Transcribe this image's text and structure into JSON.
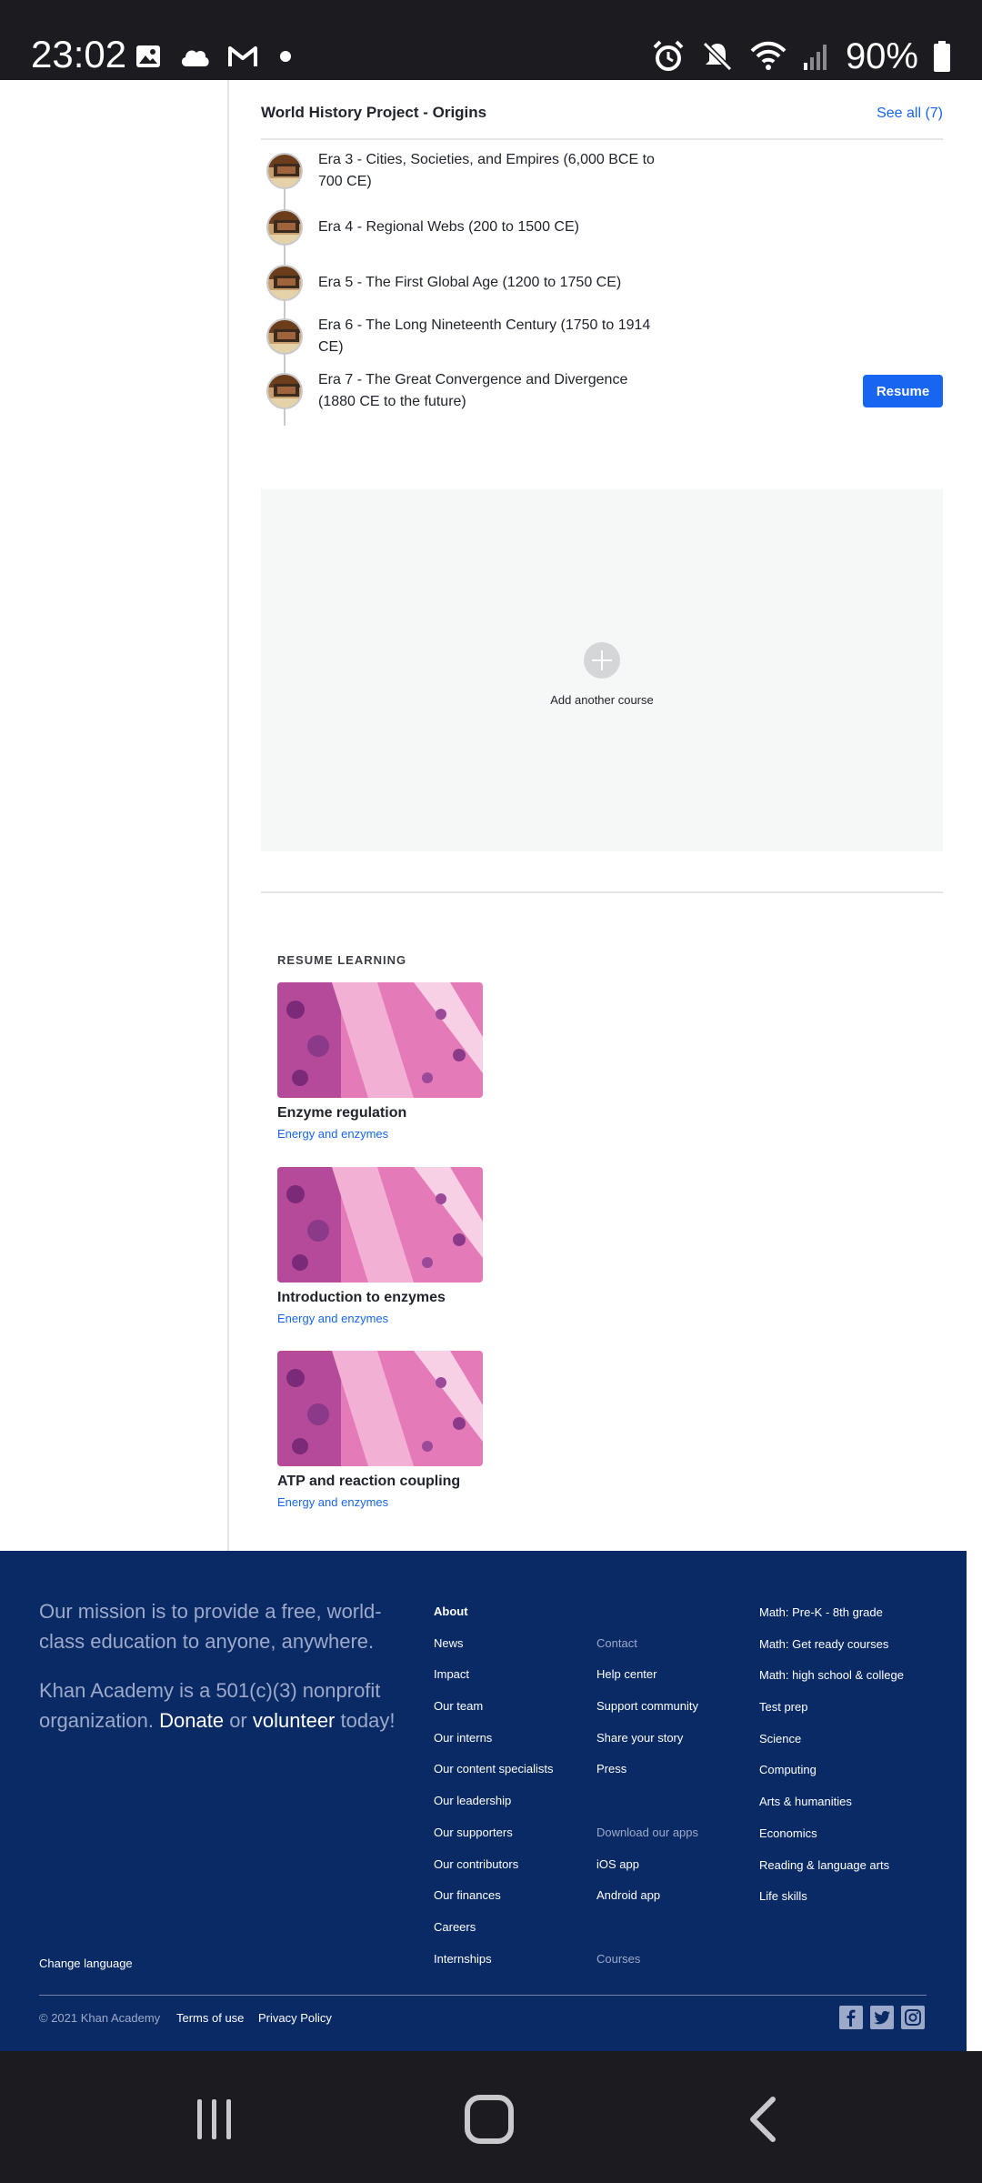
{
  "status_bar": {
    "time": "23:02",
    "battery": "90%",
    "left_icons": [
      "image-icon",
      "cloud-icon",
      "gmail-icon",
      "dot-icon"
    ],
    "right_icons": [
      "alarm-icon",
      "mute-icon",
      "wifi-icon",
      "signal-icon",
      "battery-icon"
    ]
  },
  "course": {
    "title": "World History Project - Origins",
    "see_all": "See all (7)",
    "units": [
      {
        "label": "Era 3 - Cities, Societies, and Empires (6,000 BCE to 700 CE)"
      },
      {
        "label": "Era 4 - Regional Webs (200 to 1500 CE)"
      },
      {
        "label": "Era 5 - The First Global Age (1200 to 1750 CE)"
      },
      {
        "label": "Era 6 - The Long Nineteenth Century (1750 to 1914 CE)"
      },
      {
        "label": "Era 7 - The Great Convergence and Divergence (1880 CE to the future)"
      }
    ],
    "resume_label": "Resume"
  },
  "add_course": {
    "label": "Add another course"
  },
  "resume_learning": {
    "heading": "RESUME LEARNING",
    "items": [
      {
        "title": "Enzyme regulation",
        "subtitle": "Energy and enzymes"
      },
      {
        "title": "Introduction to enzymes",
        "subtitle": "Energy and enzymes"
      },
      {
        "title": "ATP and reaction coupling",
        "subtitle": "Energy and enzymes"
      }
    ]
  },
  "footer": {
    "mission_line1": "Our mission is to provide a free, world-class education to anyone, anywhere.",
    "mission_line2_prefix": "Khan Academy is a 501(c)(3) nonprofit organization.",
    "donate": "Donate",
    "or": "or",
    "volunteer": "volunteer",
    "today": "today!",
    "about_heading": "About",
    "about_links": [
      "News",
      "Impact",
      "Our team",
      "Our interns",
      "Our content specialists",
      "Our leadership",
      "Our supporters",
      "Our contributors",
      "Our finances",
      "Careers",
      "Internships"
    ],
    "contact_heading": "Contact",
    "contact_links": [
      "Help center",
      "Support community",
      "Share your story",
      "Press"
    ],
    "apps_heading": "Download our apps",
    "apps_links": [
      "iOS app",
      "Android app"
    ],
    "courses_heading": "Courses",
    "course_links": [
      "Math: Pre-K - 8th grade",
      "Math: Get ready courses",
      "Math: high school & college",
      "Test prep",
      "Science",
      "Computing",
      "Arts & humanities",
      "Economics",
      "Reading & language arts",
      "Life skills"
    ],
    "change_language": "Change language",
    "copyright": "© 2021 Khan Academy",
    "terms": "Terms of use",
    "privacy": "Privacy Policy",
    "social": [
      "facebook-icon",
      "twitter-icon",
      "instagram-icon"
    ]
  },
  "colors": {
    "accent": "#1865f2",
    "footer_bg": "#0a2a66",
    "system_bar": "#1c1b20"
  }
}
